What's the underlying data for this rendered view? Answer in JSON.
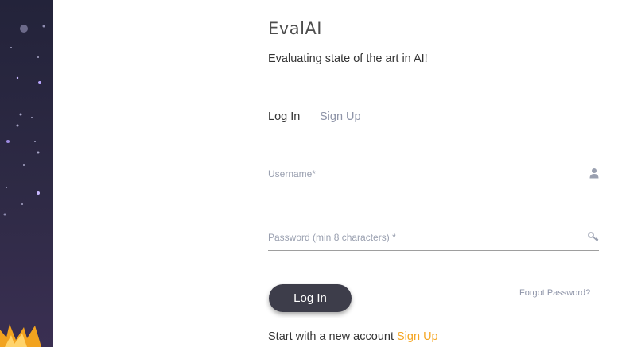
{
  "brand": {
    "logo_text": "EvalAI",
    "tagline": "Evaluating state of the art in AI!"
  },
  "tabs": [
    {
      "label": "Log In",
      "active": true
    },
    {
      "label": "Sign Up",
      "active": false
    }
  ],
  "form": {
    "username": {
      "placeholder": "Username*",
      "value": "",
      "icon": "user-icon"
    },
    "password": {
      "placeholder": "Password (min 8 characters) *",
      "value": "",
      "icon": "key-icon"
    },
    "login_label": "Log In",
    "forgot_label": "Forgot Password?"
  },
  "footer": {
    "prefix": "Start with a new account",
    "signup_label": "Sign Up"
  },
  "colors": {
    "accent": "#f5a623",
    "button": "#3d3d4a",
    "side_panel": "#2e2a45",
    "muted": "#8e94a8"
  }
}
